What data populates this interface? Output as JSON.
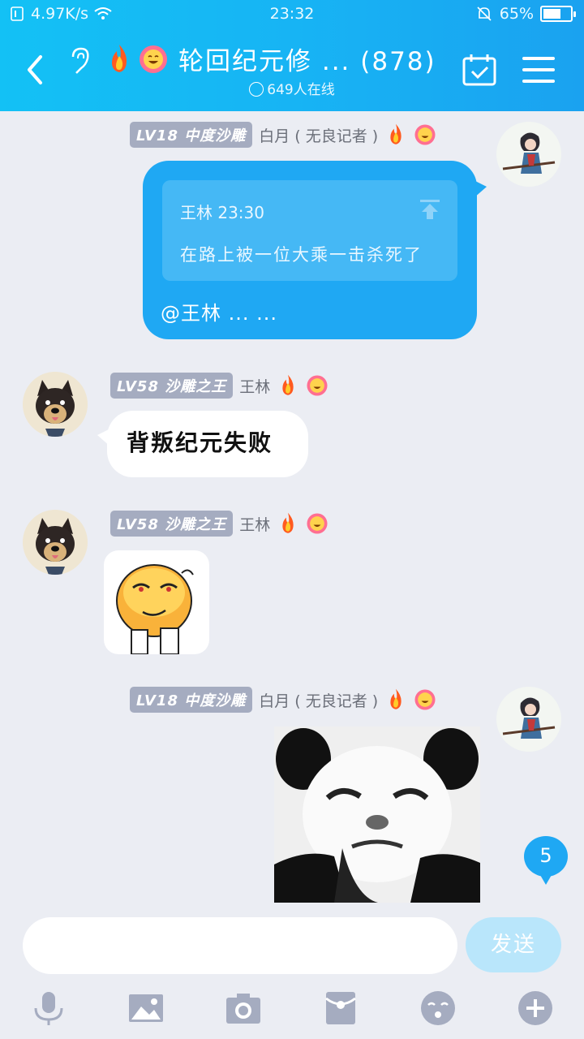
{
  "status": {
    "speed": "4.97K/s",
    "time": "23:32",
    "battery": "65%",
    "battery_level": 0.65
  },
  "header": {
    "title": "轮回纪元修 ... (878)",
    "online": "649人在线"
  },
  "messages": [
    {
      "level": "LV18",
      "rank": "中度沙雕",
      "name": "白月 ( 无良记者 )",
      "quote_head": "王林 23:30",
      "quote_body": "在路上被一位大乘一击杀死了",
      "mention": "@王林 ... ..."
    },
    {
      "level": "LV58",
      "rank": "沙雕之王",
      "name": "王林",
      "text": "背叛纪元失败"
    },
    {
      "level": "LV58",
      "rank": "沙雕之王",
      "name": "王林"
    },
    {
      "level": "LV18",
      "rank": "中度沙雕",
      "name": "白月 ( 无良记者 )"
    }
  ],
  "unread_count": "5",
  "composer": {
    "placeholder": "",
    "send_label": "发送"
  },
  "colors": {
    "header": "#17b4f4",
    "bubble": "#1fa8f3",
    "background": "#ebedf3"
  },
  "icons": [
    "back-icon",
    "ear-icon",
    "calendar-check-icon",
    "menu-icon",
    "mic-icon",
    "image-icon",
    "camera-icon",
    "red-packet-icon",
    "emoji-icon",
    "plus-icon"
  ]
}
